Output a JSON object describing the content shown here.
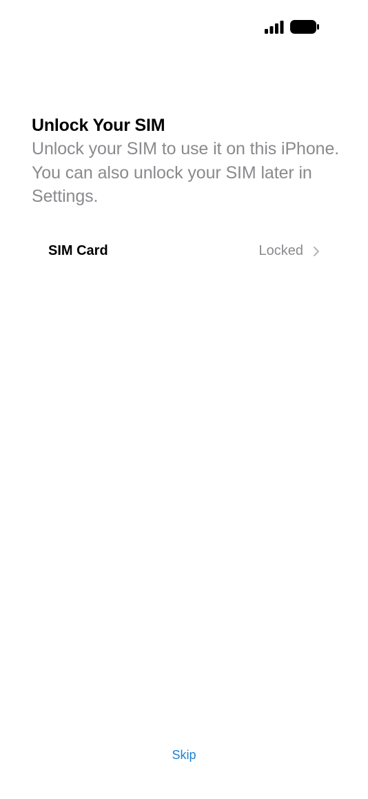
{
  "status_bar": {
    "icons": [
      "cellular-signal-icon",
      "battery-icon"
    ]
  },
  "header": {
    "title": "Unlock Your SIM",
    "subtitle": "Unlock your SIM to use it on this iPhone. You can also unlock your SIM later in Settings."
  },
  "sim_row": {
    "label": "SIM Card",
    "value": "Locked",
    "icon": "chevron-right-icon"
  },
  "footer": {
    "skip_label": "Skip"
  },
  "colors": {
    "accent": "#1a82d6",
    "secondary_text": "#8a8a8e",
    "primary_text": "#000000",
    "background": "#ffffff"
  }
}
